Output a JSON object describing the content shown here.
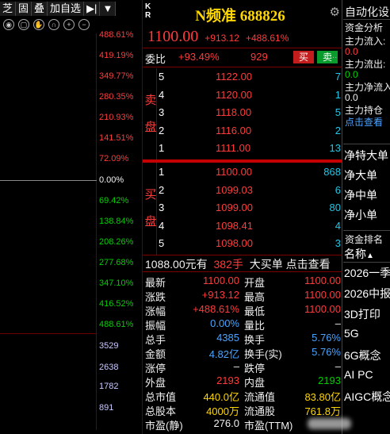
{
  "toolbar": {
    "items": [
      "芝",
      "固",
      "叠",
      "加自选",
      "▶|",
      "▼"
    ]
  },
  "chart": {
    "pct_labels": [
      {
        "text": "488.61%",
        "color": "red"
      },
      {
        "text": "419.19%",
        "color": "red"
      },
      {
        "text": "349.77%",
        "color": "red"
      },
      {
        "text": "280.35%",
        "color": "red"
      },
      {
        "text": "210.93%",
        "color": "red"
      },
      {
        "text": "141.51%",
        "color": "red"
      },
      {
        "text": "72.09%",
        "color": "red"
      },
      {
        "text": "0.00%",
        "color": "white"
      },
      {
        "text": "69.42%",
        "color": "green"
      },
      {
        "text": "138.84%",
        "color": "green"
      },
      {
        "text": "208.26%",
        "color": "green"
      },
      {
        "text": "277.68%",
        "color": "green"
      },
      {
        "text": "347.10%",
        "color": "green"
      },
      {
        "text": "416.52%",
        "color": "green"
      },
      {
        "text": "488.61%",
        "color": "green"
      }
    ],
    "vol_labels": [
      "3529",
      "2638",
      "1782",
      "891"
    ]
  },
  "quote": {
    "kr": [
      "K",
      "R"
    ],
    "title": "N频准 688826",
    "price": "1100.00",
    "change": "+913.12",
    "change_pct": "+488.61%",
    "weibi_label": "委比",
    "weibi_value": "+93.49%",
    "weicha_value": "929",
    "buy_btn": "买",
    "sell_btn": "卖",
    "more_btn": "...",
    "sell_side_label": [
      "卖",
      "盘"
    ],
    "buy_side_label": [
      "买",
      "盘"
    ],
    "sell_orders": [
      {
        "level": "5",
        "price": "1122.00",
        "vol": "7"
      },
      {
        "level": "4",
        "price": "1120.00",
        "vol": "1"
      },
      {
        "level": "3",
        "price": "1118.00",
        "vol": "5"
      },
      {
        "level": "2",
        "price": "1116.00",
        "vol": "2"
      },
      {
        "level": "1",
        "price": "1111.00",
        "vol": "13"
      }
    ],
    "buy_orders": [
      {
        "level": "1",
        "price": "1100.00",
        "vol": "868"
      },
      {
        "level": "2",
        "price": "1099.03",
        "vol": "6"
      },
      {
        "level": "3",
        "price": "1099.00",
        "vol": "80"
      },
      {
        "level": "4",
        "price": "1098.41",
        "vol": "4"
      },
      {
        "level": "5",
        "price": "1098.00",
        "vol": "3"
      }
    ],
    "big_order": {
      "amount": "1088.00",
      "amount_unit": "元有",
      "shou": "382手",
      "text": "大买单 点击查看"
    },
    "info": [
      {
        "l1": "最新",
        "v1": "1100.00",
        "c1": "red",
        "l2": "开盘",
        "v2": "1100.00",
        "c2": "red"
      },
      {
        "l1": "涨跌",
        "v1": "+913.12",
        "c1": "red",
        "l2": "最高",
        "v2": "1100.00",
        "c2": "red"
      },
      {
        "l1": "涨幅",
        "v1": "+488.61%",
        "c1": "red",
        "l2": "最低",
        "v2": "1100.00",
        "c2": "red"
      },
      {
        "l1": "振幅",
        "v1": "0.00%",
        "c1": "blue",
        "l2": "量比",
        "v2": "–",
        "c2": "white"
      },
      {
        "l1": "总手",
        "v1": "4385",
        "c1": "blue",
        "l2": "换手",
        "v2": "5.76%",
        "c2": "blue"
      },
      {
        "l1": "金额",
        "v1": "4.82亿",
        "c1": "blue",
        "l2": "换手(实)",
        "v2": "5.76%",
        "c2": "blue"
      },
      {
        "l1": "涨停",
        "v1": "–",
        "c1": "white",
        "l2": "跌停",
        "v2": "–",
        "c2": "white"
      },
      {
        "l1": "外盘",
        "v1": "2193",
        "c1": "red",
        "l2": "内盘",
        "v2": "2193",
        "c2": "green"
      },
      {
        "l1": "总市值",
        "v1": "440.0亿",
        "c1": "yellow",
        "l2": "流通值",
        "v2": "83.80亿",
        "c2": "yellow"
      },
      {
        "l1": "总股本",
        "v1": "4000万",
        "c1": "yellow",
        "l2": "流通股",
        "v2": "761.8万",
        "c2": "yellow"
      },
      {
        "l1": "市盈(静)",
        "v1": "276.0",
        "c1": "white",
        "l2": "市盈(TTM)",
        "v2": "",
        "c2": "white"
      }
    ]
  },
  "right_panel": {
    "header": "自动化设",
    "fund_analysis": "资金分析",
    "flows": [
      {
        "label": "主力流入:",
        "value": "0.0",
        "color": "red"
      },
      {
        "label": "主力流出:",
        "value": "0.0",
        "color": "green"
      },
      {
        "label": "主力净流入",
        "value": "0.0",
        "color": "white"
      },
      {
        "label": "主力持仓",
        "value": "点击查看",
        "color": "blue"
      }
    ],
    "net_items": [
      "净特大单",
      "净大单",
      "净中单",
      "净小单"
    ],
    "rank_header": "资金排名",
    "name_col": "名称",
    "sectors": [
      "2026一季",
      "2026中报",
      "3D打印",
      "5G",
      "6G概念",
      "AI PC",
      "AIGC概念"
    ]
  }
}
